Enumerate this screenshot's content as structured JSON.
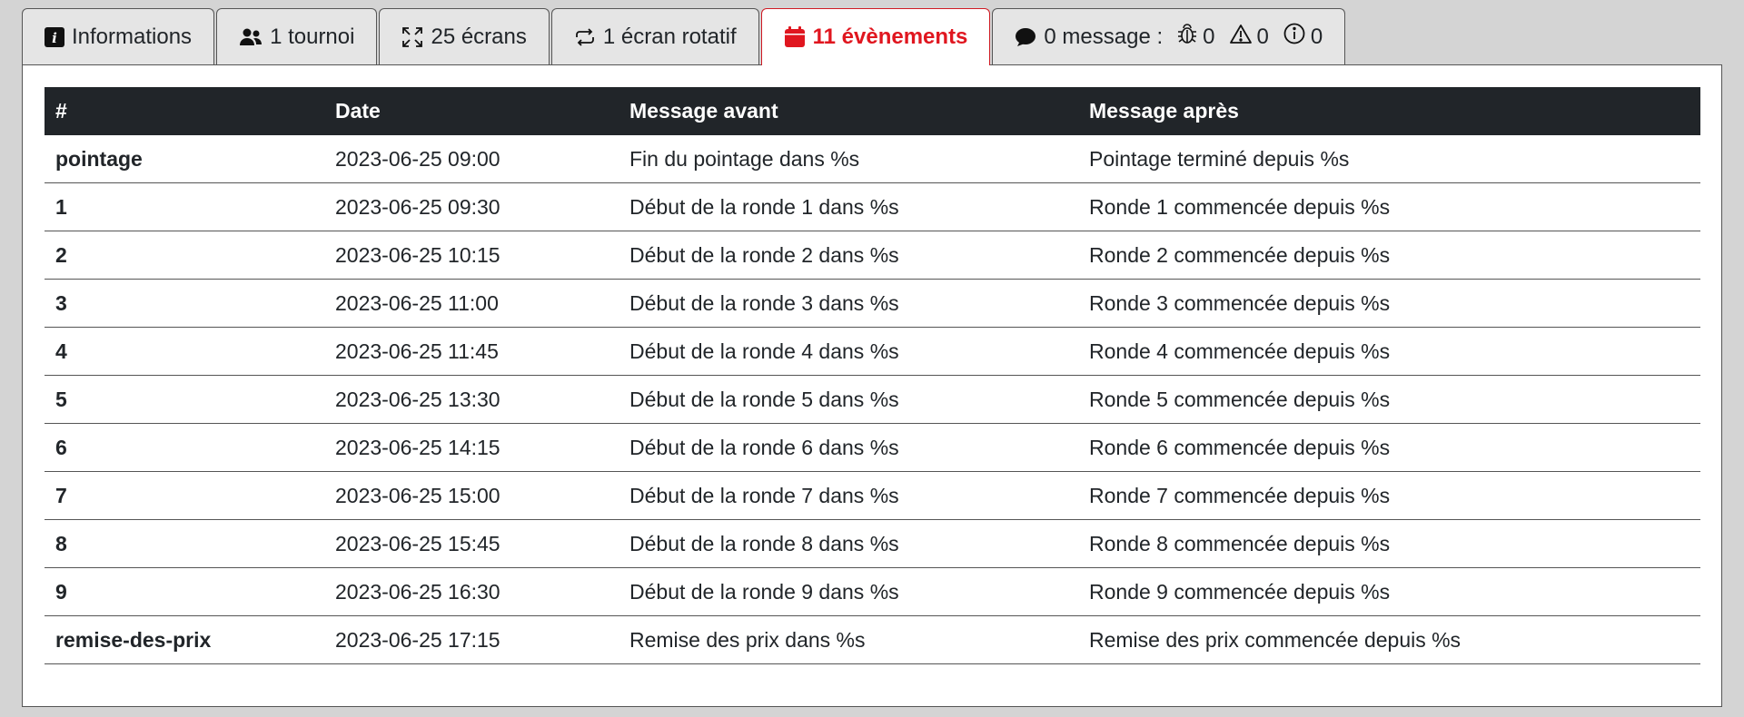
{
  "tabs": [
    {
      "label": "Informations",
      "icon": "info-square-icon"
    },
    {
      "label": "1 tournoi",
      "icon": "users-icon"
    },
    {
      "label": "25 écrans",
      "icon": "fullscreen-icon"
    },
    {
      "label": "1 écran rotatif",
      "icon": "repeat-icon"
    },
    {
      "label": "11 évènements",
      "icon": "calendar-icon",
      "active": true
    },
    {
      "label": "0 message :",
      "icon": "chat-bubble-icon",
      "counts": {
        "bugs": "0",
        "warnings": "0",
        "infos": "0"
      }
    }
  ],
  "colors": {
    "accent": "#e0161f",
    "header_bg": "#212529"
  },
  "table": {
    "headers": [
      "#",
      "Date",
      "Message avant",
      "Message après"
    ],
    "rows": [
      [
        "pointage",
        "2023-06-25 09:00",
        "Fin du pointage dans %s",
        "Pointage terminé depuis %s"
      ],
      [
        "1",
        "2023-06-25 09:30",
        "Début de la ronde 1 dans %s",
        "Ronde 1 commencée depuis %s"
      ],
      [
        "2",
        "2023-06-25 10:15",
        "Début de la ronde 2 dans %s",
        "Ronde 2 commencée depuis %s"
      ],
      [
        "3",
        "2023-06-25 11:00",
        "Début de la ronde 3 dans %s",
        "Ronde 3 commencée depuis %s"
      ],
      [
        "4",
        "2023-06-25 11:45",
        "Début de la ronde 4 dans %s",
        "Ronde 4 commencée depuis %s"
      ],
      [
        "5",
        "2023-06-25 13:30",
        "Début de la ronde 5 dans %s",
        "Ronde 5 commencée depuis %s"
      ],
      [
        "6",
        "2023-06-25 14:15",
        "Début de la ronde 6 dans %s",
        "Ronde 6 commencée depuis %s"
      ],
      [
        "7",
        "2023-06-25 15:00",
        "Début de la ronde 7 dans %s",
        "Ronde 7 commencée depuis %s"
      ],
      [
        "8",
        "2023-06-25 15:45",
        "Début de la ronde 8 dans %s",
        "Ronde 8 commencée depuis %s"
      ],
      [
        "9",
        "2023-06-25 16:30",
        "Début de la ronde 9 dans %s",
        "Ronde 9 commencée depuis %s"
      ],
      [
        "remise-des-prix",
        "2023-06-25 17:15",
        "Remise des prix dans %s",
        "Remise des prix commencée depuis %s"
      ]
    ]
  }
}
